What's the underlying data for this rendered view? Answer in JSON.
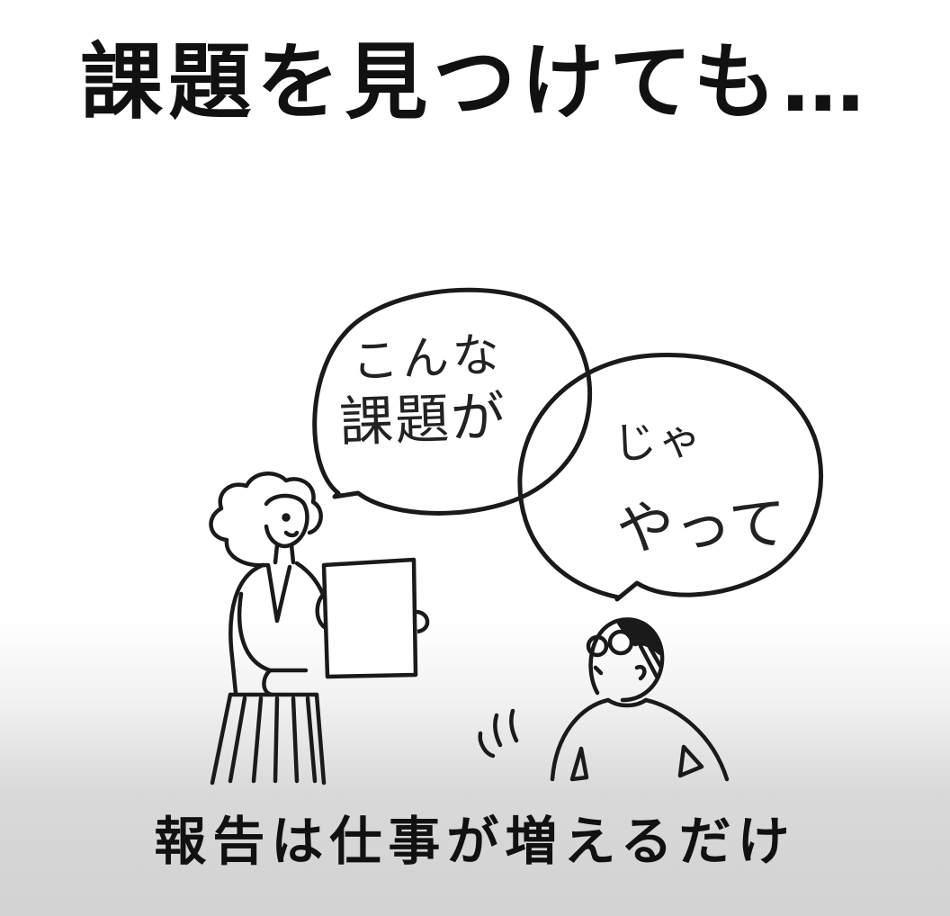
{
  "title": "課題を見つけても…",
  "bubble_left": {
    "line1": "こんな",
    "line2": "課題が"
  },
  "bubble_right": {
    "line1": "じゃ",
    "line2": "やって"
  },
  "caption": "報告は仕事が増えるだけ"
}
